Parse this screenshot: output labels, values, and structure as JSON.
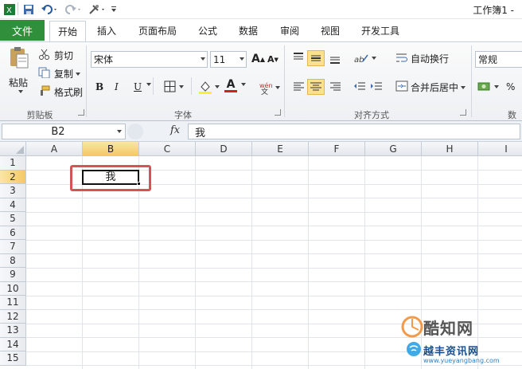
{
  "title_bar": {
    "doc_title": "工作簿1 -"
  },
  "tabs": {
    "file": "文件",
    "items": [
      "开始",
      "插入",
      "页面布局",
      "公式",
      "数据",
      "审阅",
      "视图",
      "开发工具"
    ]
  },
  "clipboard": {
    "paste": "粘贴",
    "cut": "剪切",
    "copy": "复制",
    "format_painter": "格式刷",
    "group_label": "剪贴板"
  },
  "font": {
    "font_name": "宋体",
    "font_size": "11",
    "bold": "B",
    "italic": "I",
    "underline": "U",
    "font_color_letter": "A",
    "group_label": "字体"
  },
  "alignment": {
    "wrap_text": "自动换行",
    "merge_center": "合并后居中",
    "group_label": "对齐方式"
  },
  "number": {
    "format": "常规",
    "percent": "%",
    "group_label": "数"
  },
  "formula_bar": {
    "name_box": "B2",
    "fx": "fx",
    "content": "我"
  },
  "grid": {
    "columns": [
      "A",
      "B",
      "C",
      "D",
      "E",
      "F",
      "G",
      "H",
      "I"
    ],
    "rows": [
      "1",
      "2",
      "3",
      "4",
      "5",
      "6",
      "7",
      "8",
      "9",
      "10",
      "11",
      "12",
      "13",
      "14",
      "15"
    ],
    "selected_column": "B",
    "selected_row": "2",
    "active_cell_value": "我"
  },
  "watermark": {
    "brand": "酷知网",
    "tagline": "越丰资讯网",
    "url": "www.yueyangbang.com"
  },
  "colors": {
    "file_tab": "#2f8f3a",
    "selected_header": "#f3c965",
    "highlight_box": "#d35454",
    "font_color_bar": "#d02020"
  }
}
